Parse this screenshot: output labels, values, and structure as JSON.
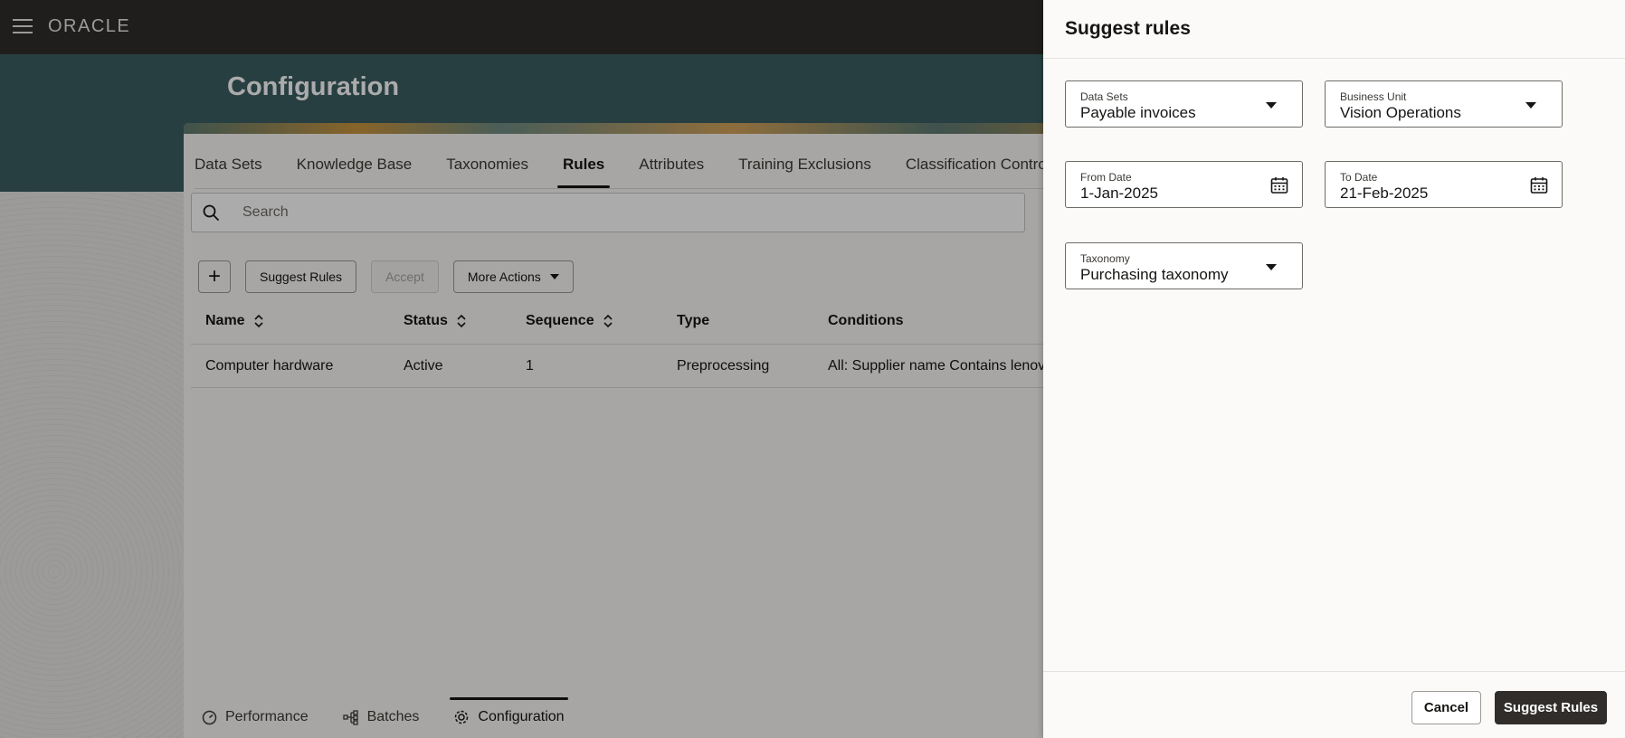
{
  "app": {
    "brand": "ORACLE",
    "page_title": "Configuration"
  },
  "tabs": [
    {
      "label": "Data Sets"
    },
    {
      "label": "Knowledge Base"
    },
    {
      "label": "Taxonomies"
    },
    {
      "label": "Rules",
      "active": true
    },
    {
      "label": "Attributes"
    },
    {
      "label": "Training Exclusions"
    },
    {
      "label": "Classification Controls"
    }
  ],
  "search": {
    "placeholder": "Search"
  },
  "toolbar": {
    "add_label": "+",
    "suggest_label": "Suggest Rules",
    "accept_label": "Accept",
    "more_label": "More Actions"
  },
  "table": {
    "columns": [
      "Name",
      "Status",
      "Sequence",
      "Type",
      "Conditions"
    ],
    "rows": [
      {
        "name": "Computer hardware",
        "status": "Active",
        "sequence": "1",
        "type": "Preprocessing",
        "conditions": "All: Supplier name Contains lenovo"
      }
    ]
  },
  "bottom_nav": [
    {
      "label": "Performance"
    },
    {
      "label": "Batches"
    },
    {
      "label": "Configuration",
      "active": true
    }
  ],
  "drawer": {
    "title": "Suggest rules",
    "data_sets": {
      "label": "Data Sets",
      "value": "Payable invoices"
    },
    "business_unit": {
      "label": "Business Unit",
      "value": "Vision Operations"
    },
    "from_date": {
      "label": "From Date",
      "value": "1-Jan-2025"
    },
    "to_date": {
      "label": "To Date",
      "value": "21-Feb-2025"
    },
    "taxonomy": {
      "label": "Taxonomy",
      "value": "Purchasing taxonomy"
    },
    "cancel_label": "Cancel",
    "submit_label": "Suggest Rules"
  },
  "colors": {
    "header_bg": "#312d2a",
    "banner_bg": "#3c5f63",
    "primary_button": "#312d2a"
  }
}
